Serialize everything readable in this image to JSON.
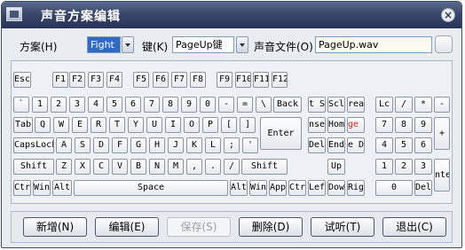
{
  "window": {
    "title": "声音方案编辑",
    "close_label": "×"
  },
  "scheme": {
    "label": "方案(H)",
    "value": "Fight"
  },
  "key": {
    "label": "键(K)",
    "value": "PageUp键"
  },
  "sound_file": {
    "label": "声音文件(O)",
    "value": "PageUp.wav",
    "browse_label": ""
  },
  "keyboard": {
    "rows": [
      [
        {
          "id": "esc",
          "label": "Esc"
        },
        {
          "id": "f1",
          "label": "F1"
        },
        {
          "id": "f2",
          "label": "F2"
        },
        {
          "id": "f3",
          "label": "F3"
        },
        {
          "id": "f4",
          "label": "F4"
        },
        {
          "id": "f5",
          "label": "F5"
        },
        {
          "id": "f6",
          "label": "F6"
        },
        {
          "id": "f7",
          "label": "F7"
        },
        {
          "id": "f8",
          "label": "F8"
        },
        {
          "id": "f9",
          "label": "F9"
        },
        {
          "id": "f10",
          "label": "F10"
        },
        {
          "id": "f11",
          "label": "F11"
        },
        {
          "id": "f12",
          "label": "F12"
        }
      ],
      [
        {
          "id": "backquote",
          "label": "`"
        },
        {
          "id": "1",
          "label": "1"
        },
        {
          "id": "2",
          "label": "2"
        },
        {
          "id": "3",
          "label": "3"
        },
        {
          "id": "4",
          "label": "4"
        },
        {
          "id": "5",
          "label": "5"
        },
        {
          "id": "6",
          "label": "6"
        },
        {
          "id": "7",
          "label": "7"
        },
        {
          "id": "8",
          "label": "8"
        },
        {
          "id": "9",
          "label": "9"
        },
        {
          "id": "0",
          "label": "0"
        },
        {
          "id": "minus",
          "label": "-"
        },
        {
          "id": "equal",
          "label": "="
        },
        {
          "id": "backslash",
          "label": "\\"
        },
        {
          "id": "backspace",
          "label": "Back"
        },
        {
          "id": "printscreen",
          "label": "t Sc"
        },
        {
          "id": "scrolllock",
          "label": "Scl"
        },
        {
          "id": "pause",
          "label": "reak"
        },
        {
          "id": "numlock",
          "label": "Lc"
        },
        {
          "id": "numdiv",
          "label": "/"
        },
        {
          "id": "nummul",
          "label": "*"
        },
        {
          "id": "numsub",
          "label": "-"
        }
      ],
      [
        {
          "id": "tab",
          "label": "Tab"
        },
        {
          "id": "q",
          "label": "Q"
        },
        {
          "id": "w",
          "label": "W"
        },
        {
          "id": "e",
          "label": "E"
        },
        {
          "id": "r",
          "label": "R"
        },
        {
          "id": "t",
          "label": "T"
        },
        {
          "id": "y",
          "label": "Y"
        },
        {
          "id": "u",
          "label": "U"
        },
        {
          "id": "i",
          "label": "I"
        },
        {
          "id": "o",
          "label": "O"
        },
        {
          "id": "p",
          "label": "P"
        },
        {
          "id": "lbracket",
          "label": "["
        },
        {
          "id": "rbracket",
          "label": "]"
        },
        {
          "id": "insert",
          "label": "nsert"
        },
        {
          "id": "home",
          "label": "Home"
        },
        {
          "id": "pageup",
          "label": "ge U"
        },
        {
          "id": "num7",
          "label": "7"
        },
        {
          "id": "num8",
          "label": "8"
        },
        {
          "id": "num9",
          "label": "9"
        }
      ],
      [
        {
          "id": "capslock",
          "label": "CapsLock"
        },
        {
          "id": "a",
          "label": "A"
        },
        {
          "id": "s",
          "label": "S"
        },
        {
          "id": "d",
          "label": "D"
        },
        {
          "id": "f",
          "label": "F"
        },
        {
          "id": "g",
          "label": "G"
        },
        {
          "id": "h",
          "label": "H"
        },
        {
          "id": "j",
          "label": "J"
        },
        {
          "id": "k",
          "label": "K"
        },
        {
          "id": "l",
          "label": "L"
        },
        {
          "id": "semicolon",
          "label": ";"
        },
        {
          "id": "quote",
          "label": "'"
        },
        {
          "id": "enter",
          "label": "Enter"
        },
        {
          "id": "delete",
          "label": "Dele"
        },
        {
          "id": "end",
          "label": "End"
        },
        {
          "id": "pagedown",
          "label": "e D"
        },
        {
          "id": "num4",
          "label": "4"
        },
        {
          "id": "num5",
          "label": "5"
        },
        {
          "id": "num6",
          "label": "6"
        },
        {
          "id": "numadd",
          "label": "+"
        }
      ],
      [
        {
          "id": "lshift",
          "label": "Shift"
        },
        {
          "id": "z",
          "label": "Z"
        },
        {
          "id": "x",
          "label": "X"
        },
        {
          "id": "c",
          "label": "C"
        },
        {
          "id": "v",
          "label": "V"
        },
        {
          "id": "b",
          "label": "B"
        },
        {
          "id": "n",
          "label": "N"
        },
        {
          "id": "m",
          "label": "M"
        },
        {
          "id": "comma",
          "label": ","
        },
        {
          "id": "period",
          "label": "."
        },
        {
          "id": "slash",
          "label": "/"
        },
        {
          "id": "rshift",
          "label": "Shift"
        },
        {
          "id": "up",
          "label": "Up"
        },
        {
          "id": "num1",
          "label": "1"
        },
        {
          "id": "num2",
          "label": "2"
        },
        {
          "id": "num3",
          "label": "3"
        },
        {
          "id": "numenter",
          "label": "nte"
        }
      ],
      [
        {
          "id": "lctrl",
          "label": "Ctrl"
        },
        {
          "id": "lwin",
          "label": "Win"
        },
        {
          "id": "lalt",
          "label": "Alt"
        },
        {
          "id": "space",
          "label": "Space"
        },
        {
          "id": "ralt",
          "label": "Alt"
        },
        {
          "id": "rwin",
          "label": "Win"
        },
        {
          "id": "app",
          "label": "App"
        },
        {
          "id": "rctrl",
          "label": "Ctrl"
        },
        {
          "id": "left",
          "label": "Left"
        },
        {
          "id": "down",
          "label": "Down"
        },
        {
          "id": "right",
          "label": "Righ"
        },
        {
          "id": "num0",
          "label": "0"
        },
        {
          "id": "numdel",
          "label": "Del"
        }
      ]
    ],
    "highlight_color": "#dd2222"
  },
  "buttons": {
    "add": "新增(N)",
    "edit": "编辑(E)",
    "save": "保存(S)",
    "delete": "删除(D)",
    "preview": "试听(T)",
    "exit": "退出(C)"
  }
}
